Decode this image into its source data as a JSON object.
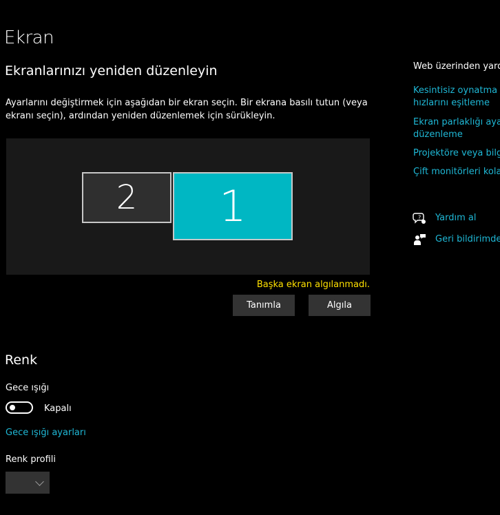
{
  "page": {
    "title": "Ekran"
  },
  "arrange": {
    "title": "Ekranlarınızı yeniden düzenleyin",
    "description": "Ayarlarını değiştirmek için aşağıdan bir ekran seçin. Bir ekrana basılı tutun (veya ekranı seçin), ardından yeniden düzenlemek için sürükleyin.",
    "monitors": [
      {
        "label": "2",
        "selected": false,
        "color": "#2f2f2f"
      },
      {
        "label": "1",
        "selected": true,
        "color": "#00b7c3"
      }
    ],
    "warning": "Başka ekran algılanmadı.",
    "identify_label": "Tanımla",
    "detect_label": "Algıla"
  },
  "color": {
    "title": "Renk",
    "night_light_label": "Gece ışığı",
    "night_light_state": "Kapalı",
    "night_light_on": false,
    "night_light_settings_link": "Gece ışığı ayarları",
    "color_profile_label": "Renk profili",
    "color_profile_value": ""
  },
  "side": {
    "heading": "Web üzerinden yardı",
    "links": [
      {
        "line1": "Kesintisiz oynatma iç",
        "line2": "hızlarını eşitleme"
      },
      {
        "line1": "Ekran parlaklığı ayarl",
        "line2": "düzenleme"
      },
      {
        "line1": "Projektöre veya bilgis",
        "line2": ""
      },
      {
        "line1": "Çift monitörleri kolay",
        "line2": ""
      }
    ],
    "help_label": "Yardım al",
    "help_icon": "chat-help-icon",
    "feedback_label": "Geri bildirimde",
    "feedback_icon": "feedback-person-icon"
  },
  "colors": {
    "accent": "#00b7c3",
    "link": "#1fb8d6",
    "warning": "#ffe100",
    "background": "#000000"
  }
}
